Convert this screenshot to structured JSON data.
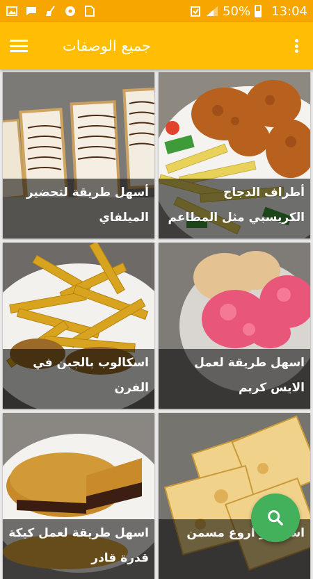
{
  "status_bar": {
    "battery_percent": "50%",
    "time": "13:04",
    "icons": [
      "image-icon",
      "message-icon",
      "broom-icon",
      "soccer-ball-icon",
      "sim-card-icon",
      "battery-saver-icon",
      "signal-icon",
      "battery-icon"
    ]
  },
  "app_bar": {
    "title": "جميع الوصفات",
    "menu_icon": "hamburger-menu-icon",
    "more_icon": "more-vert-icon"
  },
  "recipes": [
    {
      "title": "أسهل طريقة لتحضير الميلفاي",
      "image": "millefeuille"
    },
    {
      "title": "أطراف الدجاج الكريسبي مثل المطاعم",
      "image": "crispy-chicken"
    },
    {
      "title": "اسكالوب بالجبن في الفرن",
      "image": "fries"
    },
    {
      "title": "اسهل طريقة لعمل الايس كريم",
      "image": "ice-cream"
    },
    {
      "title": "اسهل طريقة لعمل كيكة قدرة قادر",
      "image": "flan-cake"
    },
    {
      "title": "اسهل و اروع مسمن",
      "image": "msemen"
    }
  ],
  "fab": {
    "icon": "search-icon"
  },
  "colors": {
    "status_bar": "#f7a600",
    "app_bar": "#ffbd03",
    "fab": "#43b05c"
  }
}
